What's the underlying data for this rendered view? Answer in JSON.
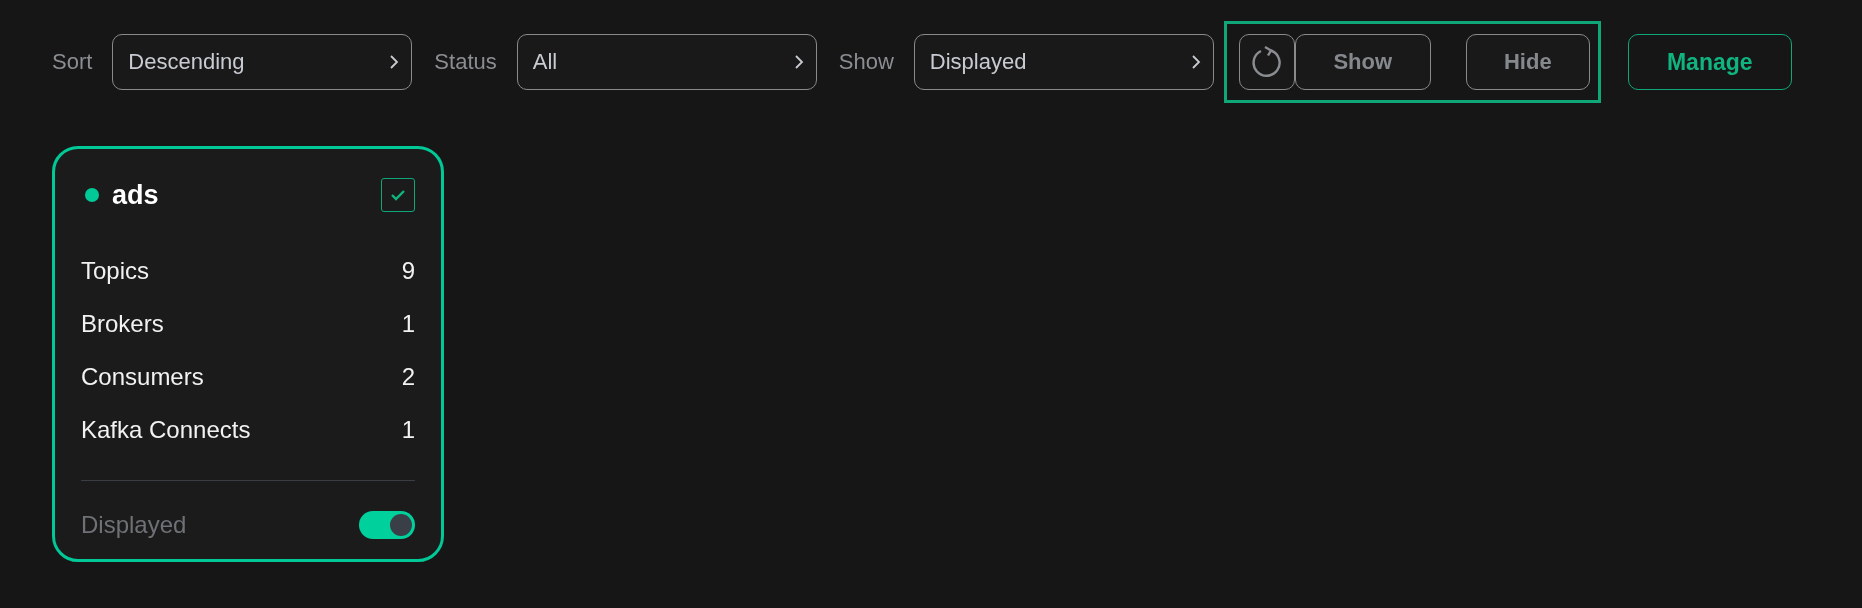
{
  "toolbar": {
    "filters": [
      {
        "label": "Sort",
        "value": "Descending"
      },
      {
        "label": "Status",
        "value": "All"
      },
      {
        "label": "Show",
        "value": "Displayed"
      }
    ],
    "refresh_button": {
      "highlighted": true
    },
    "actions": [
      {
        "label": "Show",
        "disabled": true
      },
      {
        "label": "Hide",
        "disabled": true
      }
    ],
    "manage_button": "Manage"
  },
  "clusters": [
    {
      "name": "ads",
      "color": "#00c896",
      "checked": true,
      "stats": [
        {
          "label": "Topics",
          "value": "9"
        },
        {
          "label": "Brokers",
          "value": "1"
        },
        {
          "label": "Consumers",
          "value": "2"
        },
        {
          "label": "Kafka Connects",
          "value": "1"
        }
      ],
      "toggle": {
        "label": "Displayed",
        "on": true
      }
    }
  ]
}
